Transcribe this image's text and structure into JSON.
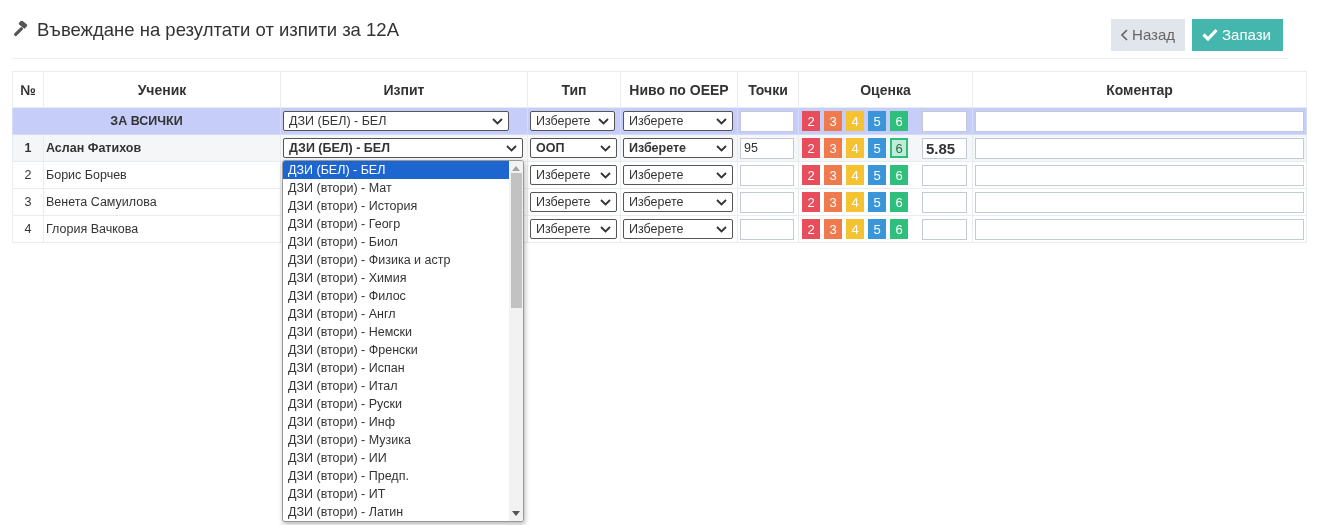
{
  "page": {
    "title": "Въвеждане на резултати от изпити за 12А"
  },
  "actions": [
    {
      "kind": "back",
      "label": "Назад"
    },
    {
      "kind": "save",
      "label": "Запази"
    }
  ],
  "table": {
    "columns": [
      "№",
      "Ученик",
      "Изпит",
      "Тип",
      "Ниво по ОЕЕР",
      "Точки",
      "Оценка",
      "Коментар"
    ],
    "all_row": {
      "label": "ЗА ВСИЧКИ",
      "exam": "ДЗИ (БЕЛ) - БЕЛ",
      "type": "Изберете",
      "level": "Изберете",
      "grades": [
        {
          "label": "2",
          "color": "#e84d5b",
          "selected": false
        },
        {
          "label": "3",
          "color": "#ef7a4e",
          "selected": false
        },
        {
          "label": "4",
          "color": "#f5c331",
          "selected": false
        },
        {
          "label": "5",
          "color": "#3a96d8",
          "selected": false
        },
        {
          "label": "6",
          "color": "#2fbf7c",
          "selected": false
        }
      ]
    },
    "rows": [
      {
        "number": "1",
        "name": "Аслан Фатихов",
        "active": true,
        "exam": "ДЗИ (БЕЛ) - БЕЛ",
        "type": "ООП",
        "level": "Изберете",
        "points": "95",
        "grade_value": "5.85",
        "grades": [
          {
            "label": "2",
            "color": "#e84d5b",
            "selected": false
          },
          {
            "label": "3",
            "color": "#ef7a4e",
            "selected": false
          },
          {
            "label": "4",
            "color": "#f5c331",
            "selected": false
          },
          {
            "label": "5",
            "color": "#3a96d8",
            "selected": false
          },
          {
            "label": "6",
            "color": "#2fbf7c",
            "selected": true
          }
        ]
      },
      {
        "number": "2",
        "name": "Борис Борчев",
        "active": false,
        "type": "Изберете",
        "level": "Изберете",
        "grades": [
          {
            "label": "2",
            "color": "#e84d5b",
            "selected": false
          },
          {
            "label": "3",
            "color": "#ef7a4e",
            "selected": false
          },
          {
            "label": "4",
            "color": "#f5c331",
            "selected": false
          },
          {
            "label": "5",
            "color": "#3a96d8",
            "selected": false
          },
          {
            "label": "6",
            "color": "#2fbf7c",
            "selected": false
          }
        ]
      },
      {
        "number": "3",
        "name": "Венета Самуилова",
        "active": false,
        "type": "Изберете",
        "level": "Изберете",
        "grades": [
          {
            "label": "2",
            "color": "#e84d5b",
            "selected": false
          },
          {
            "label": "3",
            "color": "#ef7a4e",
            "selected": false
          },
          {
            "label": "4",
            "color": "#f5c331",
            "selected": false
          },
          {
            "label": "5",
            "color": "#3a96d8",
            "selected": false
          },
          {
            "label": "6",
            "color": "#2fbf7c",
            "selected": false
          }
        ]
      },
      {
        "number": "4",
        "name": "Глория Вачкова",
        "active": false,
        "type": "Изберете",
        "level": "Изберете",
        "grades": [
          {
            "label": "2",
            "color": "#e84d5b",
            "selected": false
          },
          {
            "label": "3",
            "color": "#ef7a4e",
            "selected": false
          },
          {
            "label": "4",
            "color": "#f5c331",
            "selected": false
          },
          {
            "label": "5",
            "color": "#3a96d8",
            "selected": false
          },
          {
            "label": "6",
            "color": "#2fbf7c",
            "selected": false
          }
        ]
      }
    ]
  },
  "exam_dropdown": {
    "options": [
      {
        "label": "ДЗИ (БЕЛ) - БЕЛ",
        "selected": true
      },
      {
        "label": "ДЗИ (втори) - Мат",
        "selected": false
      },
      {
        "label": "ДЗИ (втори) - История",
        "selected": false
      },
      {
        "label": "ДЗИ (втори) - Геогр",
        "selected": false
      },
      {
        "label": "ДЗИ (втори) - Биол",
        "selected": false
      },
      {
        "label": "ДЗИ (втори) - Физика и астр",
        "selected": false
      },
      {
        "label": "ДЗИ (втори) - Химия",
        "selected": false
      },
      {
        "label": "ДЗИ (втори) - Филос",
        "selected": false
      },
      {
        "label": "ДЗИ (втори) - Англ",
        "selected": false
      },
      {
        "label": "ДЗИ (втори) - Немски",
        "selected": false
      },
      {
        "label": "ДЗИ (втори) - Френски",
        "selected": false
      },
      {
        "label": "ДЗИ (втори) - Испан",
        "selected": false
      },
      {
        "label": "ДЗИ (втори) - Итал",
        "selected": false
      },
      {
        "label": "ДЗИ (втори) - Руски",
        "selected": false
      },
      {
        "label": "ДЗИ (втори) - Инф",
        "selected": false
      },
      {
        "label": "ДЗИ (втори) - Музика",
        "selected": false
      },
      {
        "label": "ДЗИ (втори) - ИИ",
        "selected": false
      },
      {
        "label": "ДЗИ (втори) - Предп.",
        "selected": false
      },
      {
        "label": "ДЗИ (втори) - ИТ",
        "selected": false
      },
      {
        "label": "ДЗИ (втори) - Латин",
        "selected": false
      }
    ]
  }
}
